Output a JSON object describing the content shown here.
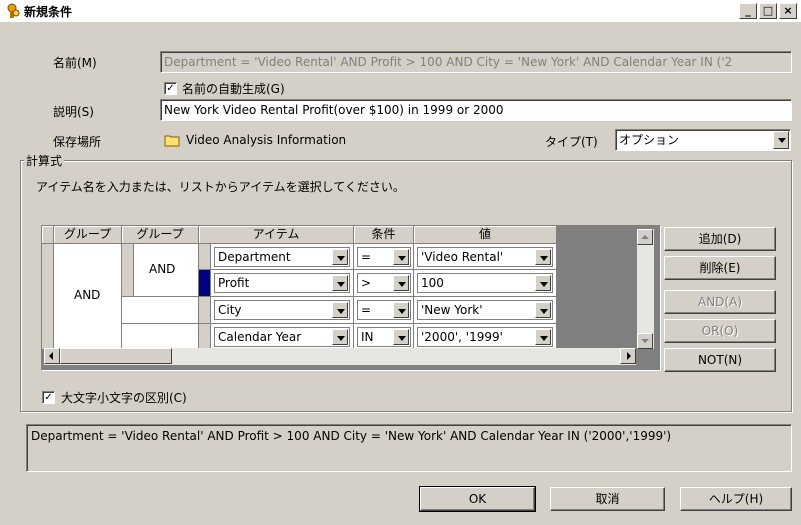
{
  "window": {
    "title": "新規条件",
    "controls": [
      "_",
      "□",
      "×"
    ]
  },
  "form": {
    "name_label": "名前(M)",
    "name_value": "Department = 'Video Rental' AND Profit > 100 AND City = 'New York' AND Calendar Year IN ('2",
    "auto_name_label": "名前の自動生成(G)",
    "auto_name_checked": true,
    "desc_label": "説明(S)",
    "desc_value": "New York Video Rental Profit(over $100) in 1999 or 2000",
    "location_label": "保存場所",
    "location_value": "Video Analysis Information",
    "type_label": "タイプ(T)",
    "type_value": "オプション"
  },
  "expression": {
    "group_label": "計算式",
    "instruction": "アイテム名を入力または、リストからアイテムを選択してください。",
    "headers": [
      "グループ",
      "グループ",
      "アイテム",
      "条件",
      "値"
    ],
    "outer_group": "AND",
    "inner_group": "AND",
    "rows": [
      {
        "item": "Department",
        "op": "=",
        "value": "'Video Rental'"
      },
      {
        "item": "Profit",
        "op": ">",
        "value": "100"
      },
      {
        "item": "City",
        "op": "=",
        "value": "'New York'"
      },
      {
        "item": "Calendar Year",
        "op": "IN",
        "value": "'2000', '1999'"
      }
    ],
    "case_label": "大文字小文字の区別(C)",
    "case_checked": true
  },
  "side_buttons": {
    "add": "追加(D)",
    "delete": "削除(E)",
    "and": "AND(A)",
    "or": "OR(O)",
    "not": "NOT(N)"
  },
  "summary": "Department = 'Video Rental' AND Profit > 100 AND City = 'New York' AND Calendar Year IN ('2000','1999')",
  "footer": {
    "ok": "OK",
    "cancel": "取消",
    "help": "ヘルプ(H)"
  }
}
